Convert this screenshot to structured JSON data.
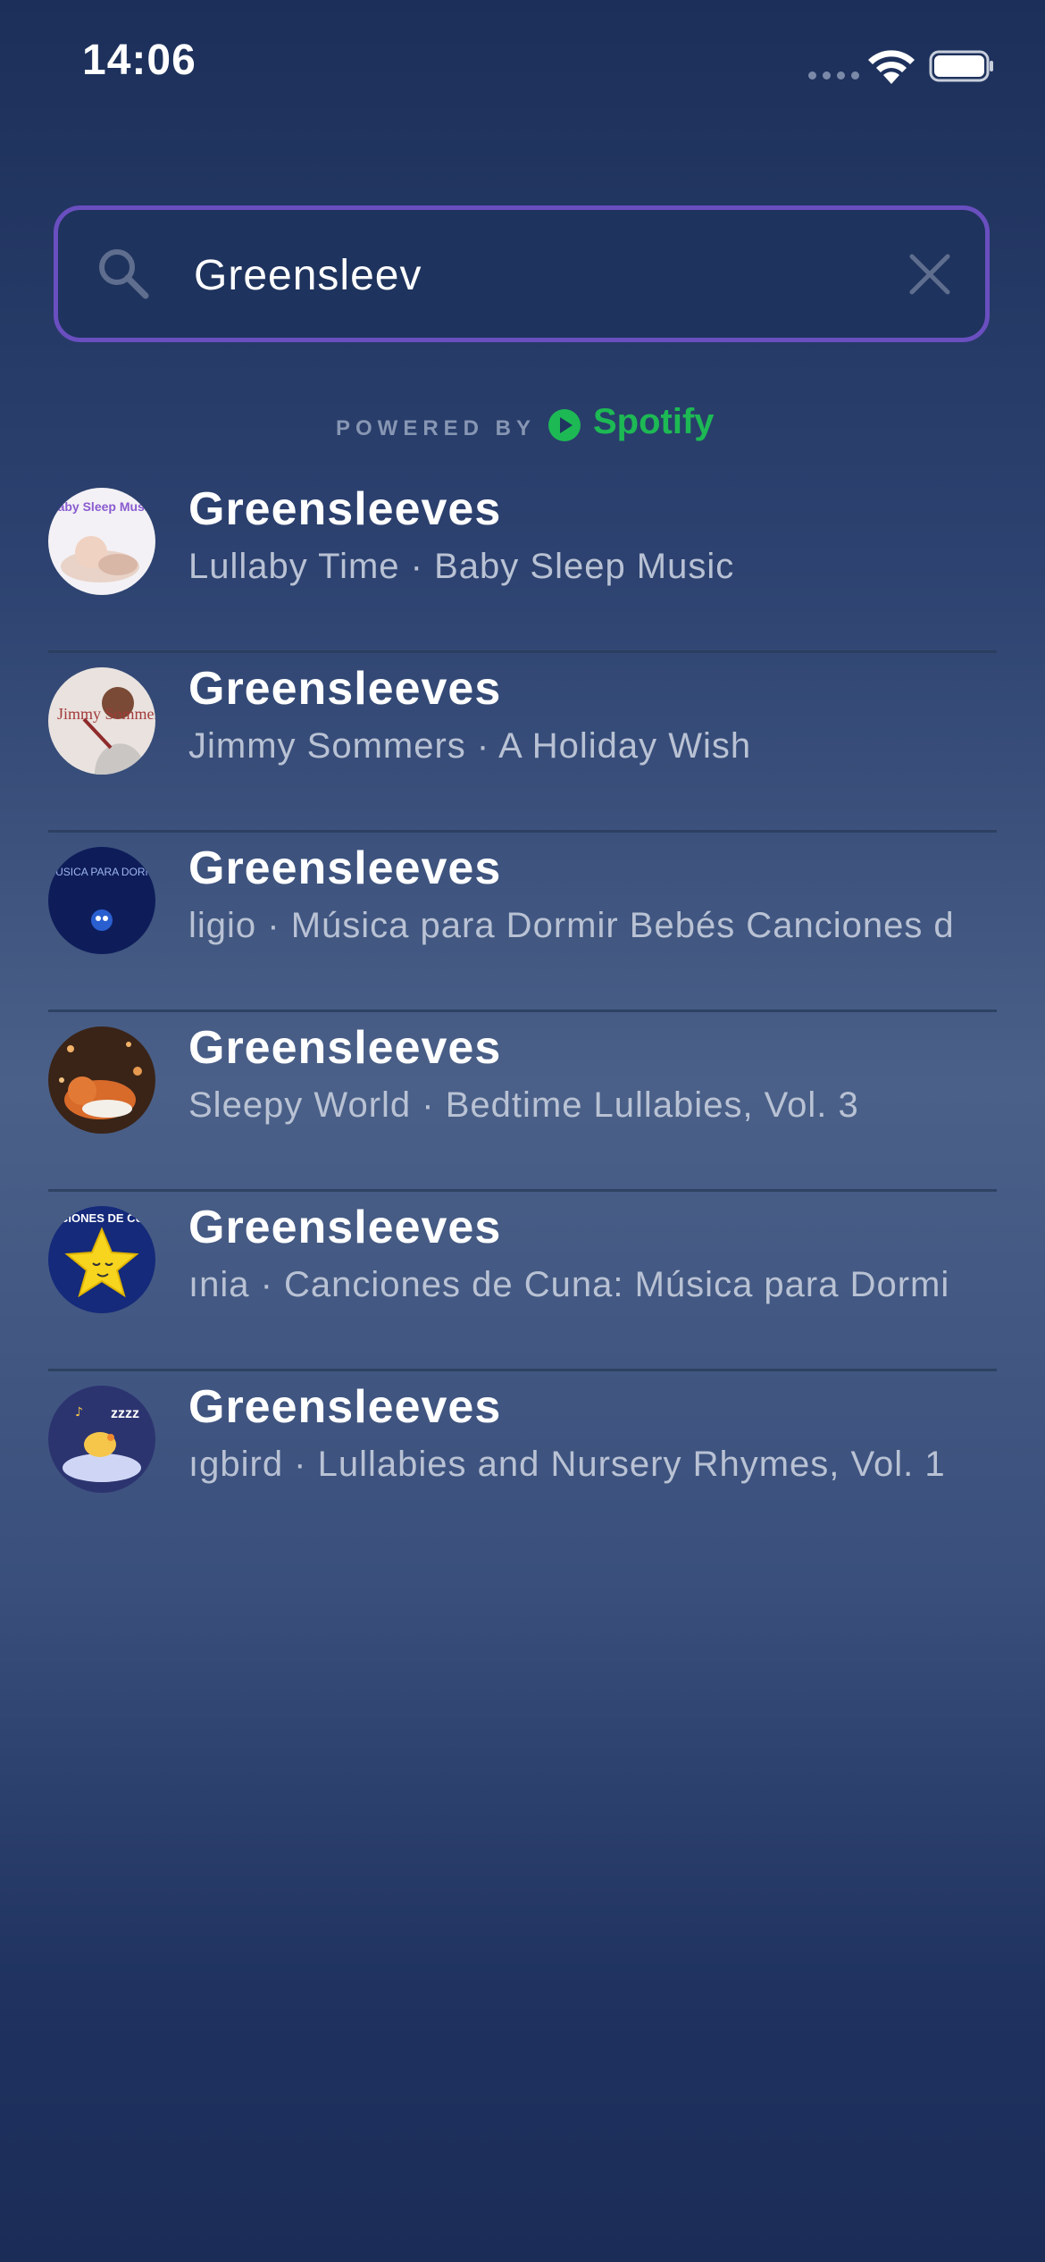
{
  "status_bar": {
    "time": "14:06"
  },
  "search": {
    "value": "Greensleev"
  },
  "powered_by": {
    "label": "POWERED BY",
    "brand": "Spotify",
    "brand_color": "#1db954"
  },
  "results": [
    {
      "title": "Greensleeves",
      "subtitle": "Lullaby Time · Baby Sleep Music"
    },
    {
      "title": "Greensleeves",
      "subtitle": "Jimmy Sommers · A Holiday Wish"
    },
    {
      "title": "Greensleeves",
      "subtitle": "ligio · Música para Dormir Bebés Canciones d"
    },
    {
      "title": "Greensleeves",
      "subtitle": "Sleepy World · Bedtime Lullabies, Vol. 3"
    },
    {
      "title": "Greensleeves",
      "subtitle": "ınia · Canciones de Cuna: Música para Dormi"
    },
    {
      "title": "Greensleeves",
      "subtitle": "ıgbird · Lullabies and Nursery Rhymes, Vol. 1"
    }
  ],
  "artwork_text": {
    "row1": "Baby Sleep Music",
    "row2": "Jimmy Sommers",
    "row3": "MUSICA PARA DORMIR BEBES",
    "row5": "CIONES DE CU",
    "row6": "zzzz"
  },
  "colors": {
    "search_border": "#6a4fc0",
    "accent": "#1db954"
  }
}
